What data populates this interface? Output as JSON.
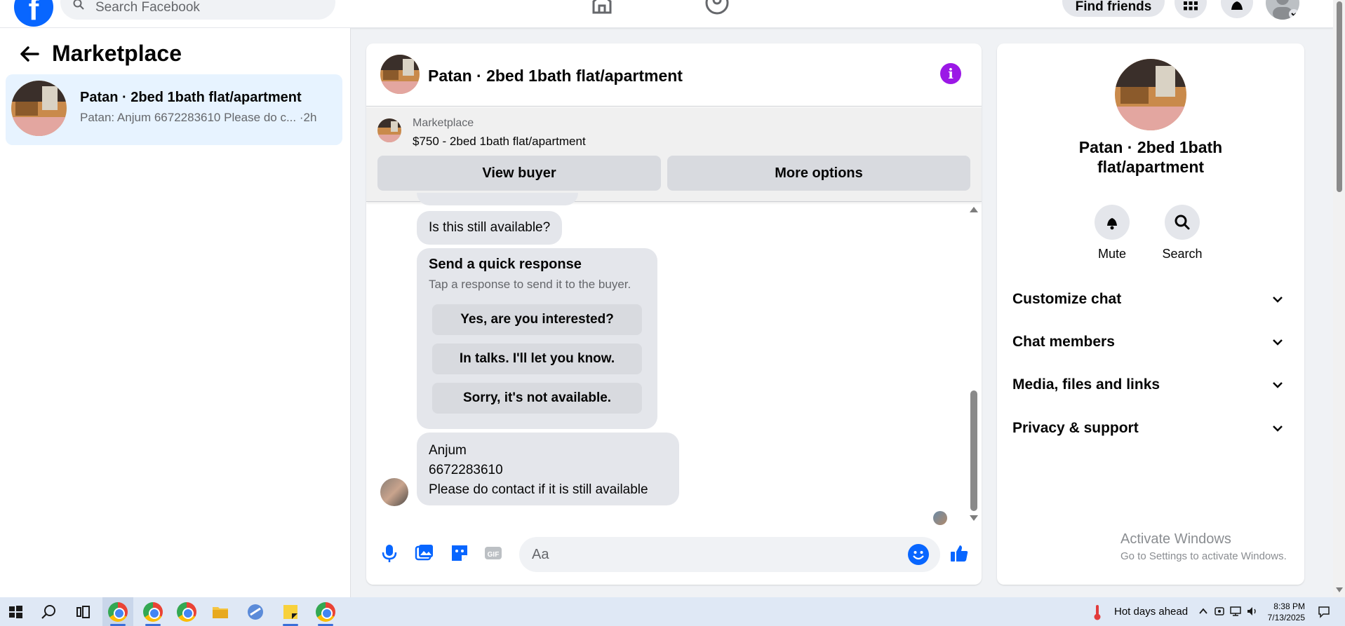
{
  "topnav": {
    "search_placeholder": "Search Facebook",
    "find_friends_label": "Find friends"
  },
  "sidebar": {
    "title": "Marketplace",
    "conversations": [
      {
        "name": "Patan · 2bed 1bath flat/apartment",
        "preview": "Patan: Anjum 6672283610 Please do c... ·2h"
      }
    ]
  },
  "chat": {
    "title": "Patan · 2bed 1bath flat/apartment",
    "banner": {
      "label": "Marketplace",
      "listing": "$750 - 2bed 1bath flat/apartment",
      "view_buyer_label": "View buyer",
      "more_options_label": "More options"
    },
    "messages": {
      "m1": "Is this still available?",
      "quick_response": {
        "title": "Send a quick response",
        "subtitle": "Tap a response to send it to the buyer.",
        "options": [
          "Yes, are you interested?",
          "In talks. I'll let you know.",
          "Sorry, it's not available."
        ]
      },
      "m3_lines": [
        "Anjum",
        "6672283610",
        "Please do contact if it is still available"
      ]
    },
    "composer_placeholder": "Aa"
  },
  "info_panel": {
    "title": "Patan · 2bed 1bath flat/apartment",
    "actions": [
      {
        "label": "Mute",
        "icon": "bell-icon"
      },
      {
        "label": "Search",
        "icon": "search-icon"
      }
    ],
    "sections": [
      "Customize chat",
      "Chat members",
      "Media, files and links",
      "Privacy & support"
    ],
    "activate_title": "Activate Windows",
    "activate_sub": "Go to Settings to activate Windows."
  },
  "taskbar": {
    "weather": "Hot days ahead",
    "time": "8:38 PM",
    "date": "7/13/2025"
  },
  "colors": {
    "accent": "#0866ff",
    "info_purple": "#9b18e6",
    "selected_conv": "#e7f3ff"
  }
}
